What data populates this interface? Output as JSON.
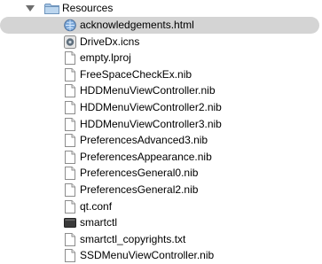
{
  "folder": {
    "name": "Resources",
    "icon": "folder-icon"
  },
  "files": [
    {
      "name": "acknowledgements.html",
      "icon": "html-document-icon",
      "selected": true
    },
    {
      "name": "DriveDx.icns",
      "icon": "icns-image-icon",
      "selected": false
    },
    {
      "name": "empty.lproj",
      "icon": "document-icon",
      "selected": false
    },
    {
      "name": "FreeSpaceCheckEx.nib",
      "icon": "document-icon",
      "selected": false
    },
    {
      "name": "HDDMenuViewController.nib",
      "icon": "document-icon",
      "selected": false
    },
    {
      "name": "HDDMenuViewController2.nib",
      "icon": "document-icon",
      "selected": false
    },
    {
      "name": "HDDMenuViewController3.nib",
      "icon": "document-icon",
      "selected": false
    },
    {
      "name": "PreferencesAdvanced3.nib",
      "icon": "document-icon",
      "selected": false
    },
    {
      "name": "PreferencesAppearance.nib",
      "icon": "document-icon",
      "selected": false
    },
    {
      "name": "PreferencesGeneral0.nib",
      "icon": "document-icon",
      "selected": false
    },
    {
      "name": "PreferencesGeneral2.nib",
      "icon": "document-icon",
      "selected": false
    },
    {
      "name": "qt.conf",
      "icon": "document-icon",
      "selected": false
    },
    {
      "name": "smartctl",
      "icon": "executable-icon",
      "selected": false
    },
    {
      "name": "smartctl_copyrights.txt",
      "icon": "document-icon",
      "selected": false
    },
    {
      "name": "SSDMenuViewController.nib",
      "icon": "document-icon",
      "selected": false
    }
  ]
}
